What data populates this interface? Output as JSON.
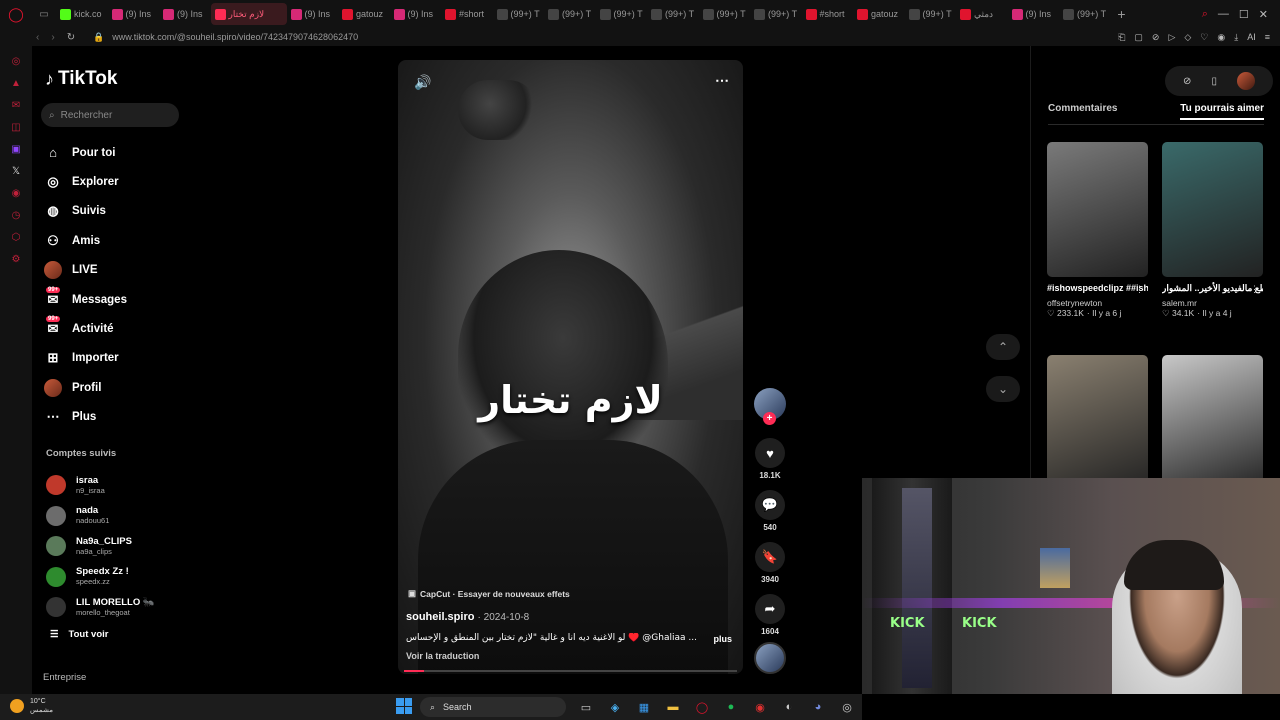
{
  "browser": {
    "tabs": [
      {
        "label": "kick.co",
        "color": "#53fc18",
        "icon": "kick-icon"
      },
      {
        "label": "(9) Ins",
        "color": "#d62976",
        "icon": "instagram-icon"
      },
      {
        "label": "(9) Ins",
        "color": "#d62976",
        "icon": "instagram-icon"
      },
      {
        "label": "لازم تختار",
        "color": "#fe2c55",
        "icon": "tiktok-icon",
        "active": true
      },
      {
        "label": "(9) Ins",
        "color": "#d62976",
        "icon": "instagram-icon"
      },
      {
        "label": "gatouz",
        "color": "#e0142e",
        "icon": "youtube-icon"
      },
      {
        "label": "(9) Ins",
        "color": "#d62976",
        "icon": "instagram-icon"
      },
      {
        "label": "#short",
        "color": "#e0142e",
        "icon": "youtube-icon"
      },
      {
        "label": "(99+) T",
        "color": "#444",
        "icon": "tiktok-icon"
      },
      {
        "label": "(99+) T",
        "color": "#444",
        "icon": "tiktok-icon"
      },
      {
        "label": "(99+) T",
        "color": "#444",
        "icon": "tiktok-icon"
      },
      {
        "label": "(99+) T",
        "color": "#444",
        "icon": "tiktok-icon"
      },
      {
        "label": "(99+) T",
        "color": "#444",
        "icon": "tiktok-icon"
      },
      {
        "label": "(99+) T",
        "color": "#444",
        "icon": "tiktok-icon"
      },
      {
        "label": "#short",
        "color": "#e0142e",
        "icon": "youtube-icon"
      },
      {
        "label": "gatouz",
        "color": "#e0142e",
        "icon": "youtube-icon"
      },
      {
        "label": "(99+) T",
        "color": "#444",
        "icon": "tiktok-icon"
      },
      {
        "label": "دمثي",
        "color": "#e0142e",
        "icon": "youtube-icon"
      },
      {
        "label": "(9) Ins",
        "color": "#d62976",
        "icon": "instagram-icon"
      },
      {
        "label": "(99+) T",
        "color": "#444",
        "icon": "tiktok-icon"
      }
    ],
    "url": "www.tiktok.com/@souheil.spiro/video/7423479074628062470"
  },
  "sidebar": {
    "logo": "TikTok",
    "search_placeholder": "Rechercher",
    "items": [
      {
        "label": "Pour toi",
        "icon": "home-icon"
      },
      {
        "label": "Explorer",
        "icon": "compass-icon"
      },
      {
        "label": "Suivis",
        "icon": "following-icon"
      },
      {
        "label": "Amis",
        "icon": "friends-icon"
      },
      {
        "label": "LIVE",
        "icon": "live-icon"
      },
      {
        "label": "Messages",
        "icon": "messages-icon",
        "badge": "99+"
      },
      {
        "label": "Activité",
        "icon": "activity-icon",
        "badge": "99+"
      },
      {
        "label": "Importer",
        "icon": "upload-icon"
      },
      {
        "label": "Profil",
        "icon": "profile-icon"
      },
      {
        "label": "Plus",
        "icon": "more-icon"
      }
    ],
    "following_title": "Comptes suivis",
    "following": [
      {
        "name": "israa",
        "handle": "n9_israa",
        "color": "#c0392b"
      },
      {
        "name": "nada",
        "handle": "nadouu61",
        "color": "#6c6c6c"
      },
      {
        "name": "Na9a_CLIPS",
        "handle": "na9a_clips",
        "color": "#5a7a5a"
      },
      {
        "name": "Speedx Zz !",
        "handle": "speedx.zz",
        "color": "#2e8b2e"
      },
      {
        "name": "LIL MORELLO 🐜",
        "handle": "morello_thegoat",
        "color": "#333"
      }
    ],
    "see_all": "Tout voir",
    "footer": "Entreprise"
  },
  "video": {
    "overlay_text": "لازم تختار",
    "capcut": "CapCut · Essayer de nouveaux effets",
    "author": "souheil.spiro",
    "date": "· 2024-10-8",
    "description": "لو الأغنية ديه أنا و غالية \"لازم تختار بين المنطق و الإحساس ♥️ @Ghaliaa ...",
    "more": "plus",
    "translate": "Voir la traduction",
    "progress": 0.06
  },
  "actions": {
    "likes": "18.1K",
    "comments": "540",
    "saves": "3940",
    "shares": "1604"
  },
  "right_panel": {
    "tab_comments": "Commentaires",
    "tab_suggested": "Tu pourrais aimer",
    "cards": [
      {
        "title": "#ishowspeedclipz ##ishowspeed",
        "account": "offsetrynewton",
        "likes": "♡ 233.1K",
        "age": "· Il y a 6 j",
        "thumb": "#7a7a7a"
      },
      {
        "title": "مقطع مالفيديو الأخير.. المشوار 🙏",
        "account": "salem.mr",
        "likes": "♡ 34.1K",
        "age": "· Il y a 4 j",
        "thumb": "#3a6a6a"
      },
      {
        "title": "",
        "account": "",
        "likes": "",
        "age": "",
        "thumb": "#8a8070"
      },
      {
        "title": "",
        "account": "",
        "likes": "",
        "age": "",
        "thumb": "#c8c8c8"
      }
    ]
  },
  "taskbar": {
    "temp": "10°C",
    "weather": "مشمس",
    "search": "Search"
  }
}
